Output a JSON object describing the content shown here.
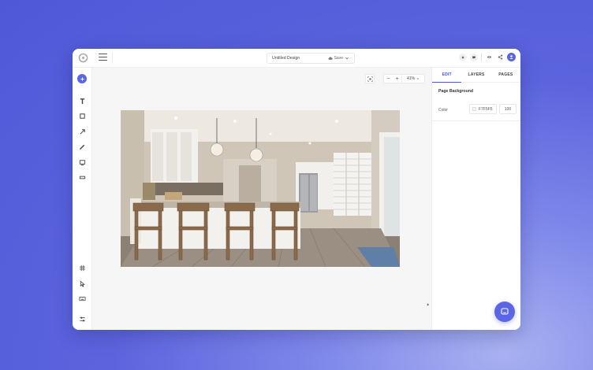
{
  "app": {
    "title": "Untitled Design",
    "save_label": "Save"
  },
  "toolbar": {
    "icons": [
      "logo-icon",
      "menu-icon",
      "close-icon",
      "comment-icon",
      "preview-eye-icon",
      "share-icon",
      "user-avatar-icon"
    ]
  },
  "left_tools": [
    "add-icon",
    "text-icon",
    "rectangle-icon",
    "arrow-icon",
    "pen-icon",
    "image-icon",
    "frame-icon",
    "grid-icon",
    "pointer-icon",
    "keyboard-icon",
    "settings-sliders-icon"
  ],
  "canvas": {
    "zoom_value": "41%",
    "zoom_out": "−",
    "zoom_in": "+"
  },
  "right_panel": {
    "tabs": [
      {
        "label": "EDIT",
        "active": true
      },
      {
        "label": "LAYERS",
        "active": false
      },
      {
        "label": "PAGES",
        "active": false
      }
    ],
    "section_title": "Page Background",
    "color_label": "Color",
    "color_hex": "F7F5F5",
    "opacity": "100"
  },
  "colors": {
    "accent": "#5a66e6",
    "background": "#4f58d8",
    "canvas": "#f6f6f6"
  }
}
